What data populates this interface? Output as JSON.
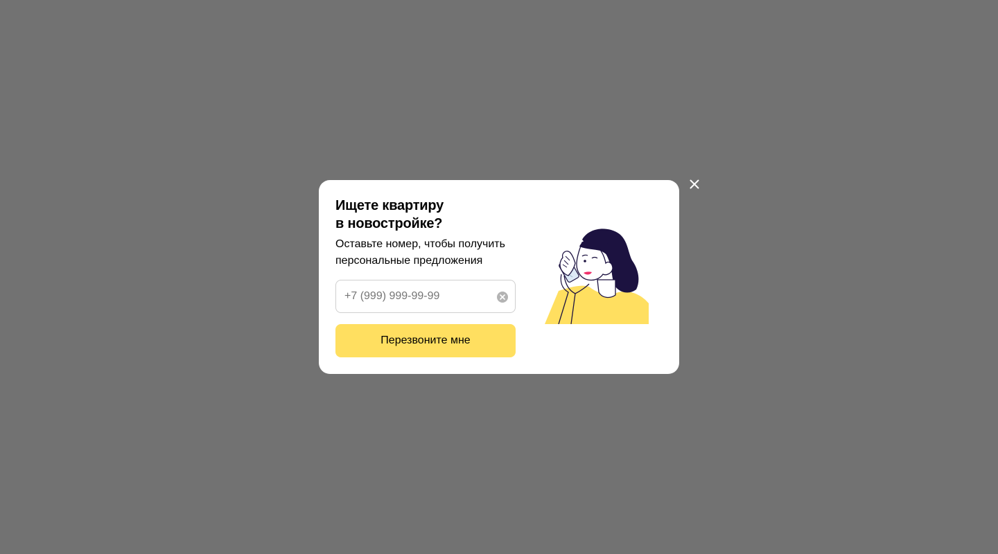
{
  "modal": {
    "title_line1": "Ищете квартиру",
    "title_line2": "в новостройке?",
    "subtitle": "Оставьте номер, чтобы получить персональные предложения",
    "phone_input": {
      "value": "",
      "placeholder": "+7 (999) 999-99-99"
    },
    "submit_label": "Перезвоните мне",
    "illustration": "woman-on-phone-illustration"
  },
  "icons": {
    "close": "close-icon",
    "clear": "clear-input-icon"
  },
  "colors": {
    "overlay": "#727272",
    "button": "#ffdf60",
    "illustration_shirt": "#ffdf60",
    "illustration_hair": "#1c1240",
    "illustration_lips": "#f0306a"
  }
}
